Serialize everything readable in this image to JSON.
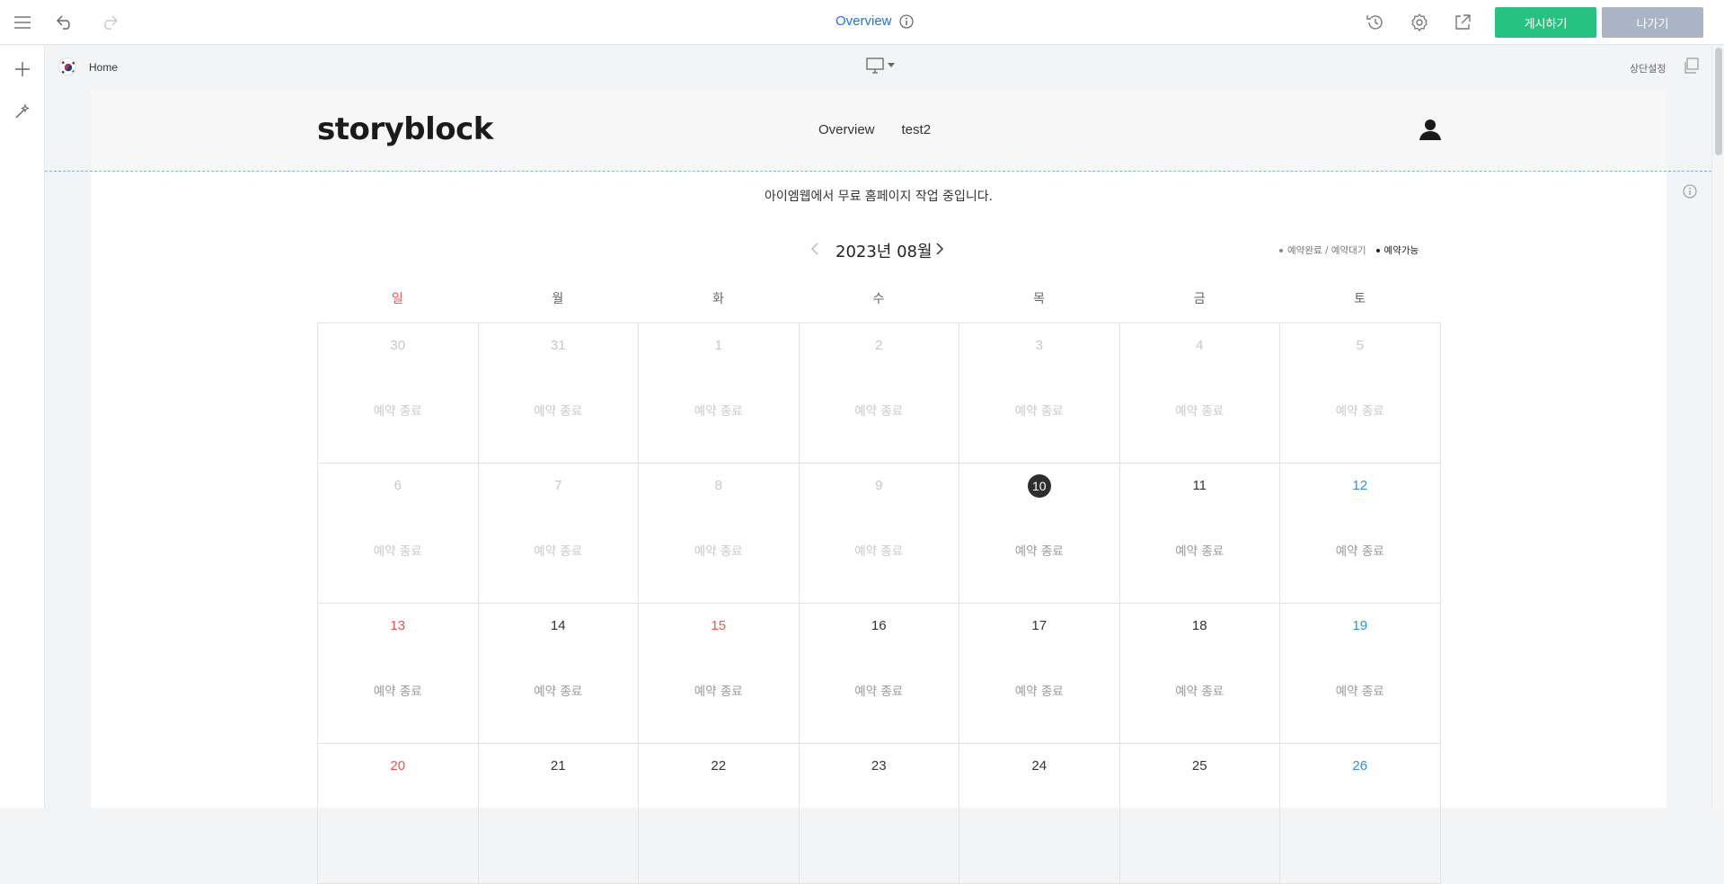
{
  "toolbar": {
    "title": "Overview",
    "publish_label": "게시하기",
    "exit_label": "나가기"
  },
  "subbar": {
    "page_label": "Home",
    "top_setting_label": "상단설정"
  },
  "site": {
    "logo": "storyblock",
    "nav": [
      "Overview",
      "test2"
    ],
    "notice": "아이엠웹에서  무료 홈페이지 작업 중입니다."
  },
  "calendar": {
    "month_label": "2023년 08월",
    "legend_booked": "예약완료 / 예약대기",
    "legend_available": "예약가능",
    "weekdays": [
      "일",
      "월",
      "화",
      "수",
      "목",
      "금",
      "토"
    ],
    "weeks": [
      [
        {
          "day": "30",
          "kind": "past",
          "status": "예약 종료"
        },
        {
          "day": "31",
          "kind": "past",
          "status": "예약 종료"
        },
        {
          "day": "1",
          "kind": "past",
          "status": "예약 종료"
        },
        {
          "day": "2",
          "kind": "past",
          "status": "예약 종료"
        },
        {
          "day": "3",
          "kind": "past",
          "status": "예약 종료"
        },
        {
          "day": "4",
          "kind": "past",
          "status": "예약 종료"
        },
        {
          "day": "5",
          "kind": "past",
          "status": "예약 종료"
        }
      ],
      [
        {
          "day": "6",
          "kind": "past",
          "status": "예약 종료"
        },
        {
          "day": "7",
          "kind": "past",
          "status": "예약 종료"
        },
        {
          "day": "8",
          "kind": "past",
          "status": "예약 종료"
        },
        {
          "day": "9",
          "kind": "past",
          "status": "예약 종료"
        },
        {
          "day": "10",
          "kind": "today",
          "status": "예약 종료"
        },
        {
          "day": "11",
          "kind": "normal",
          "status": "예약 종료"
        },
        {
          "day": "12",
          "kind": "sat",
          "status": "예약 종료"
        }
      ],
      [
        {
          "day": "13",
          "kind": "sun",
          "status": "예약 종료"
        },
        {
          "day": "14",
          "kind": "normal",
          "status": "예약 종료"
        },
        {
          "day": "15",
          "kind": "sun",
          "status": "예약 종료"
        },
        {
          "day": "16",
          "kind": "normal",
          "status": "예약 종료"
        },
        {
          "day": "17",
          "kind": "normal",
          "status": "예약 종료"
        },
        {
          "day": "18",
          "kind": "normal",
          "status": "예약 종료"
        },
        {
          "day": "19",
          "kind": "sat",
          "status": "예약 종료"
        }
      ],
      [
        {
          "day": "20",
          "kind": "sun",
          "status": ""
        },
        {
          "day": "21",
          "kind": "normal",
          "status": ""
        },
        {
          "day": "22",
          "kind": "normal",
          "status": ""
        },
        {
          "day": "23",
          "kind": "normal",
          "status": ""
        },
        {
          "day": "24",
          "kind": "normal",
          "status": ""
        },
        {
          "day": "25",
          "kind": "normal",
          "status": ""
        },
        {
          "day": "26",
          "kind": "sat",
          "status": ""
        }
      ]
    ]
  },
  "colors": {
    "publish": "#26c281",
    "exit": "#aab4c4",
    "link": "#1a73e8",
    "sunday": "#ef5350",
    "saturday": "#2f8fe6"
  },
  "icons": [
    "menu-icon",
    "undo-icon",
    "redo-icon",
    "info-icon",
    "history-icon",
    "gear-icon",
    "external-link-icon",
    "plus-icon",
    "magic-wand-icon",
    "desktop-icon",
    "chevron-down-icon",
    "copy-icon",
    "user-icon",
    "chevron-left-icon",
    "chevron-right-icon"
  ]
}
